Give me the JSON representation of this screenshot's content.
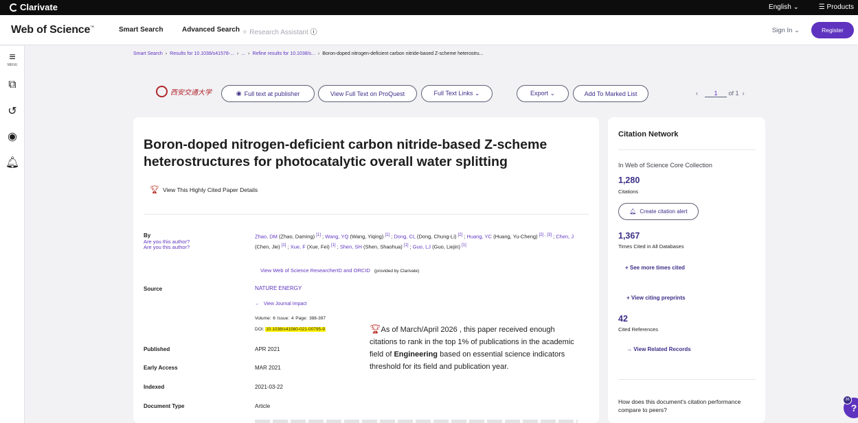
{
  "topbar": {
    "brand": "Clarivate",
    "language": "English ⌄",
    "products": "☰ Products"
  },
  "header": {
    "logo": "Web of Science",
    "logo_tm": "™",
    "nav": [
      "Smart Search",
      "Advanced Search",
      "Research Assistant"
    ],
    "signin": "Sign In ⌄",
    "register": "Register"
  },
  "rail": {
    "menu_label": "MENU"
  },
  "breadcrumb": [
    "Smart Search",
    "Results for 10.1038/s41578-...",
    "...",
    "Refine results for 10.1038/s...",
    "Boron-doped nitrogen-deficient carbon nitride-based Z-scheme heterostru..."
  ],
  "toolbar": {
    "institution": "西安交通大学",
    "full_text_publisher": "Full text at publisher",
    "proquest": "View Full Text on ProQuest",
    "full_text_links": "Full Text Links ⌄",
    "export": "Export ⌄",
    "marked_list": "Add To Marked List",
    "page_current": "1",
    "page_total": "of 1"
  },
  "record": {
    "title": "Boron-doped nitrogen-deficient carbon nitride-based Z-scheme heterostructures for photocatalytic overall water splitting",
    "highly_cited": "View This Highly Cited Paper Details",
    "labels": {
      "by": "By",
      "source": "Source",
      "published": "Published",
      "early_access": "Early Access",
      "indexed": "Indexed",
      "doc_type": "Document Type"
    },
    "author_question": "Are you this author?",
    "authors": [
      {
        "short": "Zhao, DM",
        "full": " (Zhao, Daming) ",
        "aff": "[1]",
        "sep": " ; "
      },
      {
        "short": "Wang, YQ",
        "full": " (Wang, Yiqing) ",
        "aff": "[1]",
        "sep": " ; "
      },
      {
        "short": "Dong, CL",
        "full": " (Dong, Chung-Li) ",
        "aff": "[2]",
        "sep": " ; "
      },
      {
        "short": "Huang, YC",
        "full": " (Huang, Yu-Cheng) ",
        "aff": "[2] , [3]",
        "sep": " ; "
      },
      {
        "short": "Chen, J",
        "full": " (Chen, Jie) ",
        "aff": "[1]",
        "sep": " ; "
      },
      {
        "short": "Xue, F",
        "full": " (Xue, Fei) ",
        "aff": "[1]",
        "sep": " ; "
      },
      {
        "short": "Shen, SH",
        "full": " (Shen, Shaohua) ",
        "aff": "[1]",
        "sep": " ; "
      },
      {
        "short": "Guo, LJ",
        "full": " (Guo, Liejin) ",
        "aff": "[1]",
        "sep": ""
      }
    ],
    "researcher_id": "View Web of Science ResearcherID and ORCID",
    "provided_by": "(provided by Clarivate)",
    "journal": "NATURE ENERGY",
    "journal_impact": "View Journal Impact",
    "volume_line": "Volume: 6   Issue: 4   Page: 388-397",
    "doi_label": "DOI:",
    "doi": "10.1038/s41560-021-00795-9",
    "published": "APR 2021",
    "early_access": "MAR 2021",
    "indexed": "2021-03-22",
    "doc_type": "Article",
    "esi": {
      "pre": "As of March/April 2026 , this paper received enough citations to rank in the top 1% of publications in the academic field of ",
      "field": "Engineering",
      "post": " based on essential science indicators threshold for its field and publication year."
    }
  },
  "citation_network": {
    "heading": "Citation Network",
    "collection": "In Web of Science Core Collection",
    "citations": "1,280",
    "citations_label": "Citations",
    "alert": "Create citation alert",
    "times_cited": "1,367",
    "times_cited_label": "Times Cited in All Databases",
    "see_more": "+  See more times cited",
    "citing_preprints": "+  View citing preprints",
    "cited_refs": "42",
    "cited_refs_label": "Cited References",
    "related": "→  View Related Records",
    "compare": "How does this document's citation performance compare to peers?"
  },
  "help": {
    "badge": "36",
    "icon": "?"
  },
  "colors": {
    "brand": "#5e33bf",
    "link": "#3b2f87",
    "trophy": "#b21f14",
    "doi_highlight": "#fff200"
  }
}
